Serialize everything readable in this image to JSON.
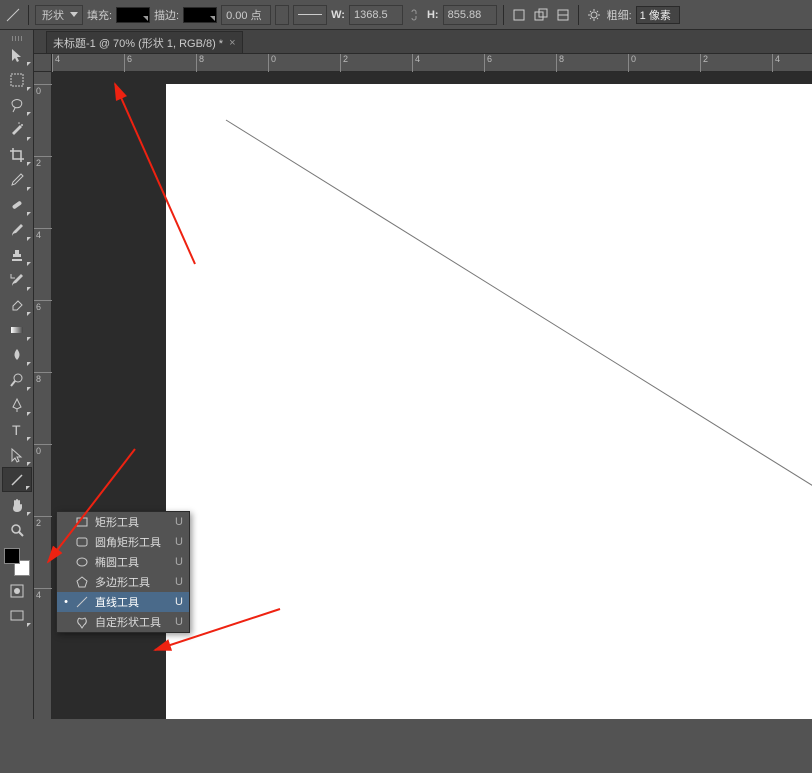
{
  "optbar": {
    "mode_label": "形状",
    "fill_label": "填充:",
    "stroke_label": "描边:",
    "stroke_width": "0.00 点",
    "w_label": "W:",
    "w_val": "1368.5",
    "h_label": "H:",
    "h_val": "855.88",
    "thickness_label": "粗细:",
    "thickness_val": "1 像素"
  },
  "tab": {
    "title": "未标题-1 @ 70% (形状 1, RGB/8) *"
  },
  "ruler_h": [
    "4",
    "6",
    "8",
    "0",
    "2",
    "4",
    "6",
    "8",
    "0",
    "2",
    "4"
  ],
  "ruler_v": [
    "0",
    "2",
    "4",
    "6",
    "8",
    "0",
    "2",
    "4"
  ],
  "popup": {
    "items": [
      {
        "name": "矩形工具",
        "key": "U",
        "sel": false,
        "icon": "rect"
      },
      {
        "name": "圆角矩形工具",
        "key": "U",
        "sel": false,
        "icon": "rrect"
      },
      {
        "name": "椭圆工具",
        "key": "U",
        "sel": false,
        "icon": "ellipse"
      },
      {
        "name": "多边形工具",
        "key": "U",
        "sel": false,
        "icon": "poly"
      },
      {
        "name": "直线工具",
        "key": "U",
        "sel": true,
        "icon": "line"
      },
      {
        "name": "自定形状工具",
        "key": "U",
        "sel": false,
        "icon": "custom"
      }
    ]
  },
  "tools": [
    "move",
    "marquee",
    "lasso",
    "wand",
    "crop",
    "eyedrop",
    "heal",
    "brush",
    "stamp",
    "history",
    "eraser",
    "gradient",
    "blur",
    "dodge",
    "pen",
    "type",
    "path",
    "line",
    "hand",
    "zoom"
  ],
  "colors": {
    "fg": "#000000",
    "bg": "#ffffff"
  }
}
